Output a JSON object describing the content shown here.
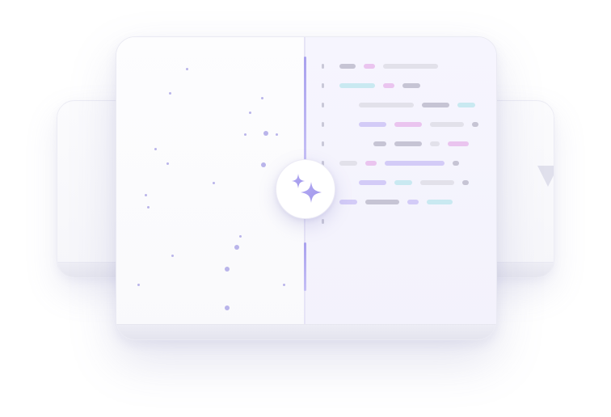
{
  "illustration": {
    "icons": {
      "center": "sparkles-icon"
    },
    "colors": {
      "accent": "#a9a1ee",
      "dot": "#b9b4ea",
      "gray": "#c6c4d4",
      "pink": "#eac4ef",
      "violet": "#d3cbf7",
      "cyan": "#c9e9f1",
      "lightgray": "#e2e1ea"
    }
  }
}
